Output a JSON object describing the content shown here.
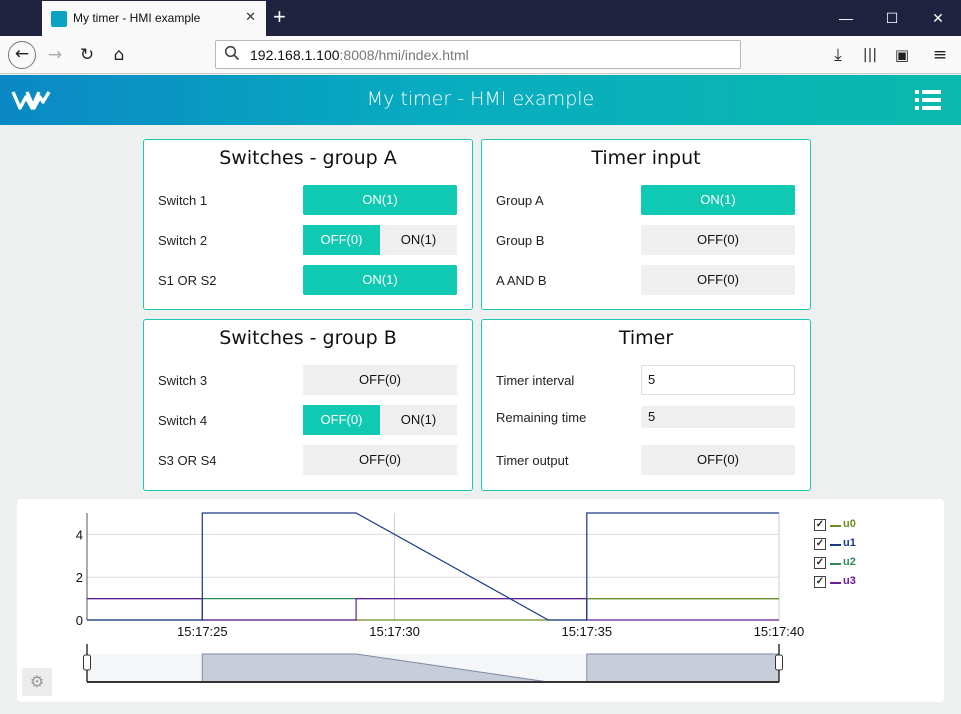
{
  "browser": {
    "tab_title": "My timer - HMI example",
    "url_host": "192.168.1.100",
    "url_rest": ":8008/hmi/index.html"
  },
  "app": {
    "title": "My timer - HMI example"
  },
  "panels": {
    "group_a": {
      "title": "Switches - group A",
      "switch1": {
        "label": "Switch 1",
        "value": "ON(1)"
      },
      "switch2": {
        "label": "Switch 2",
        "off": "OFF(0)",
        "on": "ON(1)"
      },
      "or": {
        "label": "S1 OR S2",
        "value": "ON(1)"
      }
    },
    "timer_input": {
      "title": "Timer input",
      "group_a": {
        "label": "Group A",
        "value": "ON(1)"
      },
      "group_b": {
        "label": "Group B",
        "value": "OFF(0)"
      },
      "and": {
        "label": "A AND B",
        "value": "OFF(0)"
      }
    },
    "group_b": {
      "title": "Switches - group B",
      "switch3": {
        "label": "Switch 3",
        "value": "OFF(0)"
      },
      "switch4": {
        "label": "Switch 4",
        "off": "OFF(0)",
        "on": "ON(1)"
      },
      "or": {
        "label": "S3 OR S4",
        "value": "OFF(0)"
      }
    },
    "timer": {
      "title": "Timer",
      "interval": {
        "label": "Timer interval",
        "value": "5"
      },
      "remaining": {
        "label": "Remaining time",
        "value": "5"
      },
      "output": {
        "label": "Timer output",
        "value": "OFF(0)"
      }
    }
  },
  "colors": {
    "accent": "#10c9b2",
    "u0": "#6b8e23",
    "u1": "#1a3a8a",
    "u2": "#2e8b57",
    "u3": "#6a1b9a"
  },
  "chart_data": {
    "type": "line",
    "ylim": [
      0,
      5
    ],
    "xlim": [
      "15:17:22",
      "15:17:40"
    ],
    "y_ticks": [
      0,
      2,
      4
    ],
    "x_ticks": [
      "15:17:25",
      "15:17:30",
      "15:17:35",
      "15:17:40"
    ],
    "grid": true,
    "legend_position": "right",
    "series": [
      {
        "name": "u0",
        "color": "#6b8e23",
        "points": [
          [
            "15:17:22",
            0
          ],
          [
            "15:17:35",
            0
          ],
          [
            "15:17:35",
            1
          ],
          [
            "15:17:40",
            1
          ]
        ]
      },
      {
        "name": "u1",
        "color": "#1a3a8a",
        "points": [
          [
            "15:17:22",
            0
          ],
          [
            "15:17:25",
            0
          ],
          [
            "15:17:25",
            5
          ],
          [
            "15:17:29",
            5
          ],
          [
            "15:17:34",
            0
          ],
          [
            "15:17:35",
            0
          ],
          [
            "15:17:35",
            5
          ],
          [
            "15:17:40",
            5
          ]
        ]
      },
      {
        "name": "u2",
        "color": "#2e8b57",
        "points": [
          [
            "15:17:22",
            1
          ],
          [
            "15:17:40",
            1
          ]
        ]
      },
      {
        "name": "u3",
        "color": "#6a1b9a",
        "points": [
          [
            "15:17:22",
            1
          ],
          [
            "15:17:25",
            1
          ],
          [
            "15:17:25",
            0
          ],
          [
            "15:17:29",
            0
          ],
          [
            "15:17:29",
            1
          ],
          [
            "15:17:35",
            1
          ],
          [
            "15:17:35",
            0
          ],
          [
            "15:17:40",
            0
          ]
        ]
      }
    ]
  }
}
